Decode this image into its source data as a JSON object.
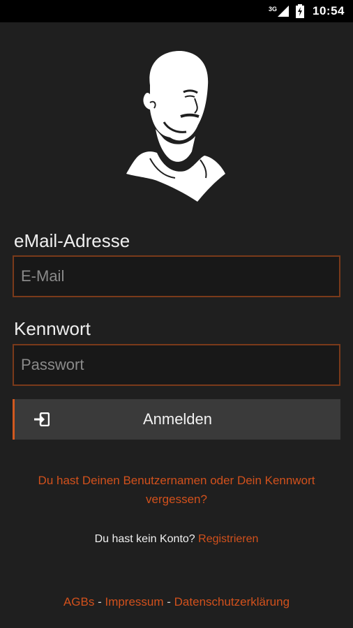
{
  "status_bar": {
    "network": "3G",
    "time": "10:54"
  },
  "login": {
    "email_label": "eMail-Adresse",
    "email_placeholder": "E-Mail",
    "email_value": "",
    "password_label": "Kennwort",
    "password_placeholder": "Passwort",
    "password_value": "",
    "submit_label": "Anmelden",
    "submit_icon": "login-icon"
  },
  "forgot_link": "Du hast Deinen Benutzernamen oder Dein Kennwort vergessen?",
  "register": {
    "text": "Du hast kein Konto? ",
    "link": "Registrieren"
  },
  "footer": {
    "agb": "AGBs",
    "impressum": "Impressum",
    "privacy": "Datenschutzerklärung",
    "separator": " - "
  },
  "colors": {
    "background": "#1f1f1f",
    "accent": "#d2511c",
    "field_border": "#7a3a1a",
    "button_bg": "#3a3a3a"
  }
}
